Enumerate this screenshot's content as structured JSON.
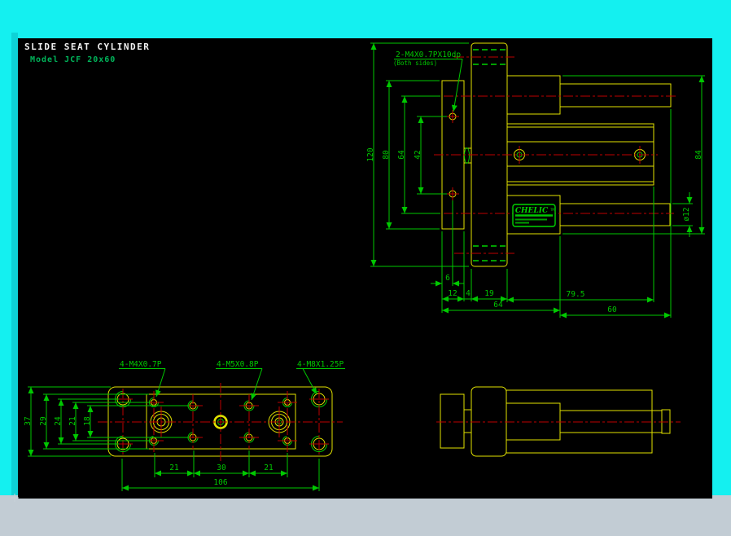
{
  "title": {
    "line1": "SLIDE SEAT CYLINDER",
    "line2": "Model JCF 20x60"
  },
  "colors": {
    "background_cyan": "#14F0F0",
    "drawing_black": "#000000",
    "bottom_strip_gray": "#C2CCD4",
    "line_yellow": "#E2E200",
    "line_green": "#00C800",
    "line_red": "#BE0000",
    "title_white": "#F2F2F2"
  },
  "front_view": {
    "thread_note_line1": "2-M4X0.7PX10dp",
    "thread_note_line2": "(Both sides)",
    "dims": {
      "overall_height": "120",
      "plate_height": "80",
      "rod_center_spacing": "64",
      "hole_spacing": "42",
      "right_height": "84",
      "rod_diameter": "ø12",
      "edge_to_hole": "6",
      "plate_thickness": "12",
      "gap": "4",
      "flange_thickness": "19",
      "base_length": "64",
      "body_length": "79.5",
      "rod_length": "60"
    }
  },
  "plan_view": {
    "labels": {
      "m4_holes": "4-M4X0.7P",
      "m5_holes": "4-M5X0.8P",
      "m8_holes": "4-M8X1.25P"
    },
    "dims": {
      "plate_width": "37",
      "table_width": "29",
      "m8_row_spacing": "24",
      "m4_row_spacing": "21",
      "m5_row_spacing": "18",
      "pitch_21a": "21",
      "pitch_30": "30",
      "pitch_21b": "21",
      "overall_length": "106"
    }
  },
  "logo": {
    "brand": "CHELIC",
    "tm": "TM"
  }
}
